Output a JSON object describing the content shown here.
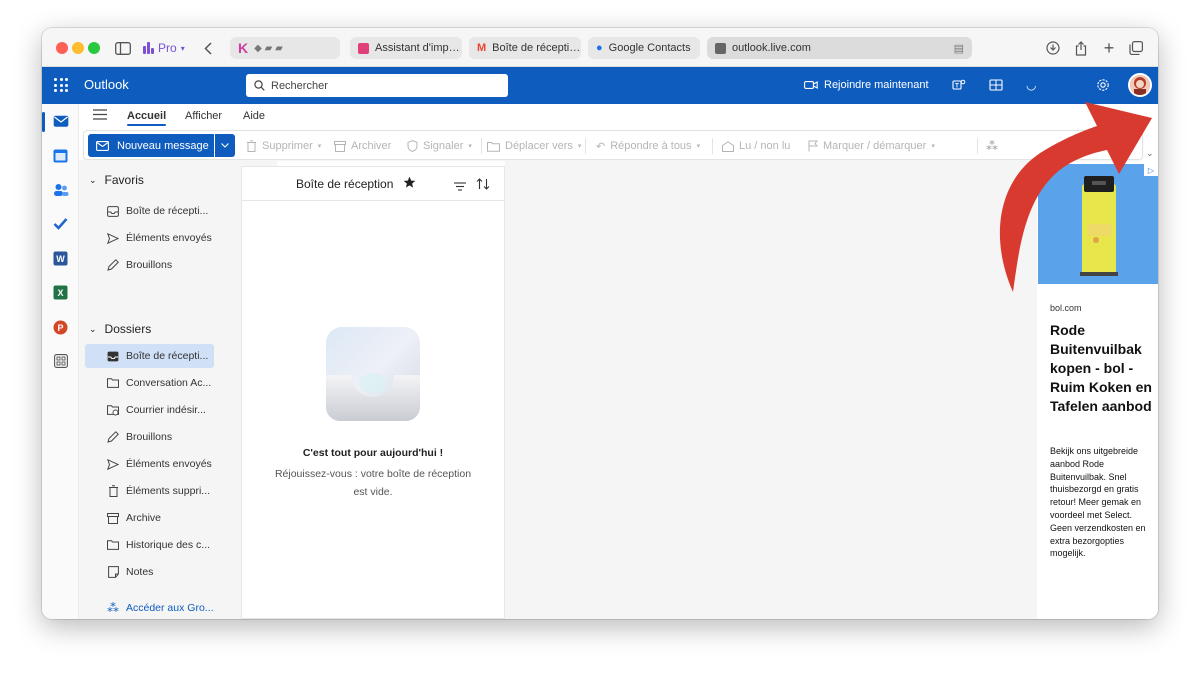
{
  "browser": {
    "pro_label": "Pro",
    "tabs": [
      {
        "label": "Assistant d'imp…",
        "color": "#e0407a"
      },
      {
        "label": "Boîte de récepti…",
        "color": "#ea4335"
      },
      {
        "label": "Google Contacts",
        "color": "#1a73e8"
      }
    ],
    "address": "outlook.live.com"
  },
  "header": {
    "app_name": "Outlook",
    "search_placeholder": "Rechercher",
    "join_label": "Rejoindre maintenant",
    "brand_color": "#0f5cbf"
  },
  "ribbon": {
    "tabs": [
      "Accueil",
      "Afficher",
      "Aide"
    ],
    "new_message": "Nouveau message",
    "actions": [
      "Supprimer",
      "Archiver",
      "Signaler",
      "Déplacer vers",
      "Répondre à tous",
      "Lu / non lu",
      "Marquer / démarquer"
    ]
  },
  "folders": {
    "favorites_label": "Favoris",
    "favorites": [
      {
        "label": "Boîte de récepti...",
        "icon": "inbox-icon"
      },
      {
        "label": "Éléments envoyés",
        "icon": "send-icon"
      },
      {
        "label": "Brouillons",
        "icon": "pencil-icon"
      }
    ],
    "folders_label": "Dossiers",
    "items": [
      {
        "label": "Boîte de récepti...",
        "icon": "inbox-icon"
      },
      {
        "label": "Conversation Ac...",
        "icon": "folder-icon"
      },
      {
        "label": "Courrier indésir...",
        "icon": "junk-icon"
      },
      {
        "label": "Brouillons",
        "icon": "pencil-icon"
      },
      {
        "label": "Éléments envoyés",
        "icon": "send-icon"
      },
      {
        "label": "Éléments suppri...",
        "icon": "trash-icon"
      },
      {
        "label": "Archive",
        "icon": "archive-icon"
      },
      {
        "label": "Historique des c...",
        "icon": "folder-icon"
      },
      {
        "label": "Notes",
        "icon": "note-icon"
      }
    ],
    "groups_label": "Accéder aux Gro..."
  },
  "message_list": {
    "title": "Boîte de réception",
    "empty_title": "C'est tout pour aujourd'hui !",
    "empty_subtitle": "Réjouissez-vous : votre boîte de réception est vide."
  },
  "ad": {
    "domain": "bol.com",
    "title": "Rode Buitenvuilbak kopen - bol - Ruim Koken en Tafelen aanbod",
    "body": "Bekijk ons uitgebreide aanbod Rode Buitenvuilbak. Snel thuisbezorgd en gratis retour! Meer gemak en voordeel met Select. Geen verzendkosten en extra bezorgopties mogelijk."
  },
  "annotation": {
    "arrow_color": "#d93a2f"
  }
}
